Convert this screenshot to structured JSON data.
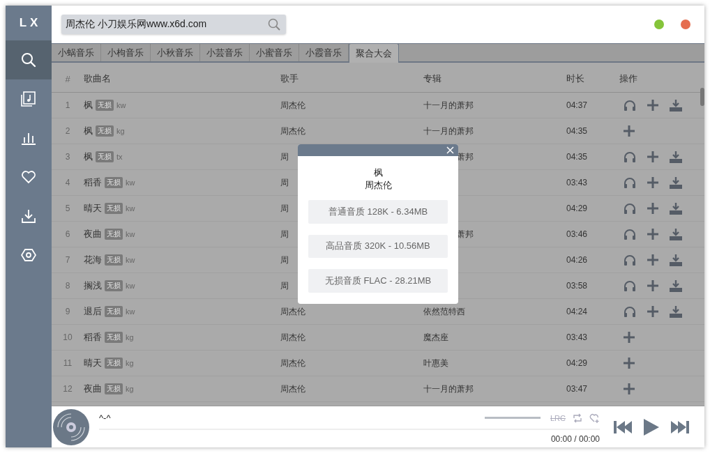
{
  "logo": "LX",
  "sidebar": {
    "items": [
      {
        "kind": "search",
        "selected": true
      },
      {
        "kind": "songlist",
        "selected": false
      },
      {
        "kind": "chart",
        "selected": false
      },
      {
        "kind": "love",
        "selected": false
      },
      {
        "kind": "download",
        "selected": false
      },
      {
        "kind": "settings",
        "selected": false
      }
    ]
  },
  "search": {
    "value": "周杰伦 小刀娱乐网www.x6d.com"
  },
  "tabs": [
    {
      "label": "小蜗音乐",
      "selected": false
    },
    {
      "label": "小枸音乐",
      "selected": false
    },
    {
      "label": "小秋音乐",
      "selected": false
    },
    {
      "label": "小芸音乐",
      "selected": false
    },
    {
      "label": "小蜜音乐",
      "selected": false
    },
    {
      "label": "小霞音乐",
      "selected": false
    },
    {
      "label": "聚合大会",
      "selected": true
    }
  ],
  "table": {
    "columns": [
      "#",
      "歌曲名",
      "歌手",
      "专辑",
      "时长",
      "操作"
    ],
    "rows": [
      {
        "index": "1",
        "name": "枫",
        "badge": "无损",
        "source": "kw",
        "singer": "周杰伦",
        "album": "十一月的萧邦",
        "duration": "04:37",
        "can_listen": true,
        "can_download": true
      },
      {
        "index": "2",
        "name": "枫",
        "badge": "无损",
        "source": "kg",
        "singer": "周杰伦",
        "album": "十一月的萧邦",
        "duration": "04:35",
        "can_listen": false,
        "can_download": false
      },
      {
        "index": "3",
        "name": "枫",
        "badge": "无损",
        "source": "tx",
        "singer": "周",
        "album_tail": "萧邦",
        "duration": "04:35",
        "can_listen": true,
        "can_download": true
      },
      {
        "index": "4",
        "name": "稻香",
        "badge": "无损",
        "source": "kw",
        "singer": "周",
        "duration": "03:43",
        "can_listen": true,
        "can_download": true
      },
      {
        "index": "5",
        "name": "晴天",
        "badge": "无损",
        "source": "kw",
        "singer": "周",
        "duration": "04:29",
        "can_listen": true,
        "can_download": true
      },
      {
        "index": "6",
        "name": "夜曲",
        "badge": "无损",
        "source": "kw",
        "singer": "周",
        "album_tail": "萧邦",
        "duration": "03:46",
        "can_listen": true,
        "can_download": true
      },
      {
        "index": "7",
        "name": "花海",
        "badge": "无损",
        "source": "kw",
        "singer": "周",
        "duration": "04:26",
        "can_listen": true,
        "can_download": true
      },
      {
        "index": "8",
        "name": "搁浅",
        "badge": "无损",
        "source": "kw",
        "singer": "周",
        "duration": "03:58",
        "can_listen": true,
        "can_download": true
      },
      {
        "index": "9",
        "name": "退后",
        "badge": "无损",
        "source": "kw",
        "singer": "周杰伦",
        "album": "依然范特西",
        "duration": "04:24",
        "can_listen": true,
        "can_download": true
      },
      {
        "index": "10",
        "name": "稻香",
        "badge": "无损",
        "source": "kg",
        "singer": "周杰伦",
        "album": "魔杰座",
        "duration": "03:43",
        "can_listen": false,
        "can_download": false
      },
      {
        "index": "11",
        "name": "晴天",
        "badge": "无损",
        "source": "kg",
        "singer": "周杰伦",
        "album": "叶惠美",
        "duration": "04:29",
        "can_listen": false,
        "can_download": false
      },
      {
        "index": "12",
        "name": "夜曲",
        "badge": "无损",
        "source": "kg",
        "singer": "周杰伦",
        "album": "十一月的萧邦",
        "duration": "03:47",
        "can_listen": false,
        "can_download": false
      }
    ]
  },
  "dialog": {
    "title": "枫",
    "subtitle": "周杰伦",
    "options": [
      "普通音质 128K - 6.34MB",
      "高品音质 320K - 10.56MB",
      "无损音质 FLAC - 28.21MB"
    ]
  },
  "player": {
    "title": "^-^",
    "lyrics_label": "LRC",
    "volume": {
      "level": 1
    },
    "progress": {
      "level": 0
    },
    "time": "00:00 / 00:00"
  }
}
